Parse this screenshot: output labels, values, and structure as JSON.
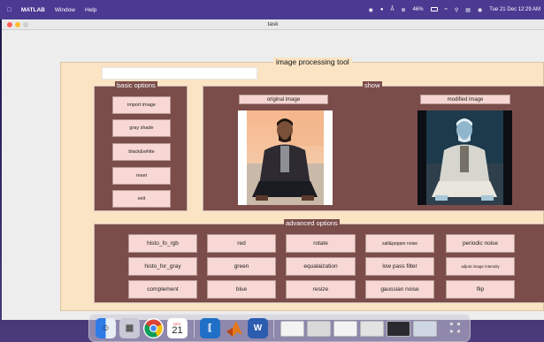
{
  "menubar": {
    "app": "MATLAB",
    "items": [
      "Window",
      "Help"
    ],
    "battery": "46%",
    "datetime": "Tue 21 Dec  12:29 AM"
  },
  "window": {
    "title": "task"
  },
  "panel": {
    "title": "image processing tool",
    "textbox_value": ""
  },
  "basic": {
    "title": "basic options",
    "buttons": [
      "import image",
      "gray shade",
      "black&white",
      "reset",
      "exit"
    ]
  },
  "show": {
    "title": "show",
    "original_label": "original image",
    "modified_label": "modified image"
  },
  "advanced": {
    "title": "advanced options",
    "rows": [
      [
        "histo_fo_rgb",
        "red",
        "rotate",
        "salt&pepper noise",
        "periodic noise"
      ],
      [
        "histo_for_gray",
        "green",
        "equalaization",
        "low pass filter",
        "adjust image intensity"
      ],
      [
        "complement",
        "blue",
        "resize",
        "gaussian noise",
        "flip"
      ]
    ]
  },
  "dock": {
    "calendar_day": "21",
    "calendar_month": "DEC"
  },
  "colors": {
    "panel_bg": "#fbe4c4",
    "group_bg": "#7b4d4a",
    "button_bg": "#f7d8d4",
    "menubar_bg": "#4a3a92"
  }
}
